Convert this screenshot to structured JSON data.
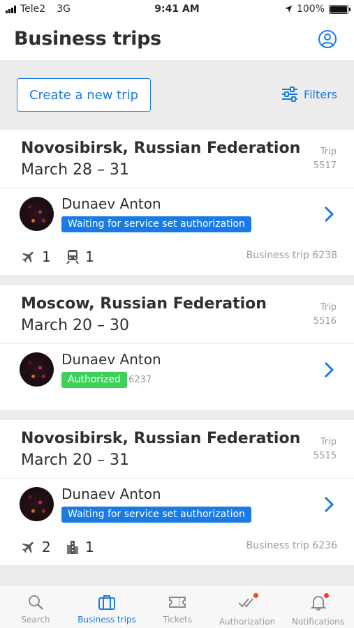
{
  "status_bar": {
    "carrier": "Tele2",
    "network": "3G",
    "time": "9:41 AM",
    "battery": "100%",
    "battery_level": 1.0
  },
  "header": {
    "title": "Business trips",
    "profile_icon": "user-circle-icon"
  },
  "actions": {
    "create_label": "Create a new trip",
    "filters_label": "Filters"
  },
  "trips": [
    {
      "city": "Novosibirsk, Russian Federation",
      "dates": "March 28 – 31",
      "trip_label": "Trip",
      "trip_number": "5517",
      "traveler": "Dunaev Anton",
      "status": "Waiting for service set authorization",
      "status_color": "#1a7be6",
      "meta": {
        "flights": "1",
        "trains": "1",
        "business_trip_ref": "Business trip 6238"
      }
    },
    {
      "city": "Moscow, Russian Federation",
      "dates": "March 20 – 30",
      "trip_label": "Trip",
      "trip_number": "5516",
      "traveler": "Dunaev Anton",
      "status": "Authorized",
      "status_color": "#3fcf5b",
      "status_number": "6237"
    },
    {
      "city": "Novosibirsk, Russian Federation",
      "dates": "March 20 – 31",
      "trip_label": "Trip",
      "trip_number": "5515",
      "traveler": "Dunaev Anton",
      "status": "Waiting for service set authorization",
      "status_color": "#1a7be6",
      "meta": {
        "flights": "2",
        "hotels": "1",
        "business_trip_ref": "Business trip 6236"
      }
    }
  ],
  "tabs": [
    {
      "label": "Search",
      "icon": "search-icon"
    },
    {
      "label": "Business trips",
      "icon": "briefcase-icon",
      "active": true
    },
    {
      "label": "Tickets",
      "icon": "ticket-icon"
    },
    {
      "label": "Authorization",
      "icon": "double-check-icon",
      "badge": true
    },
    {
      "label": "Notifications",
      "icon": "bell-icon",
      "badge": true
    }
  ],
  "colors": {
    "accent": "#1a7be6",
    "authorized": "#3fcf5b",
    "badge": "#ff3b30"
  }
}
